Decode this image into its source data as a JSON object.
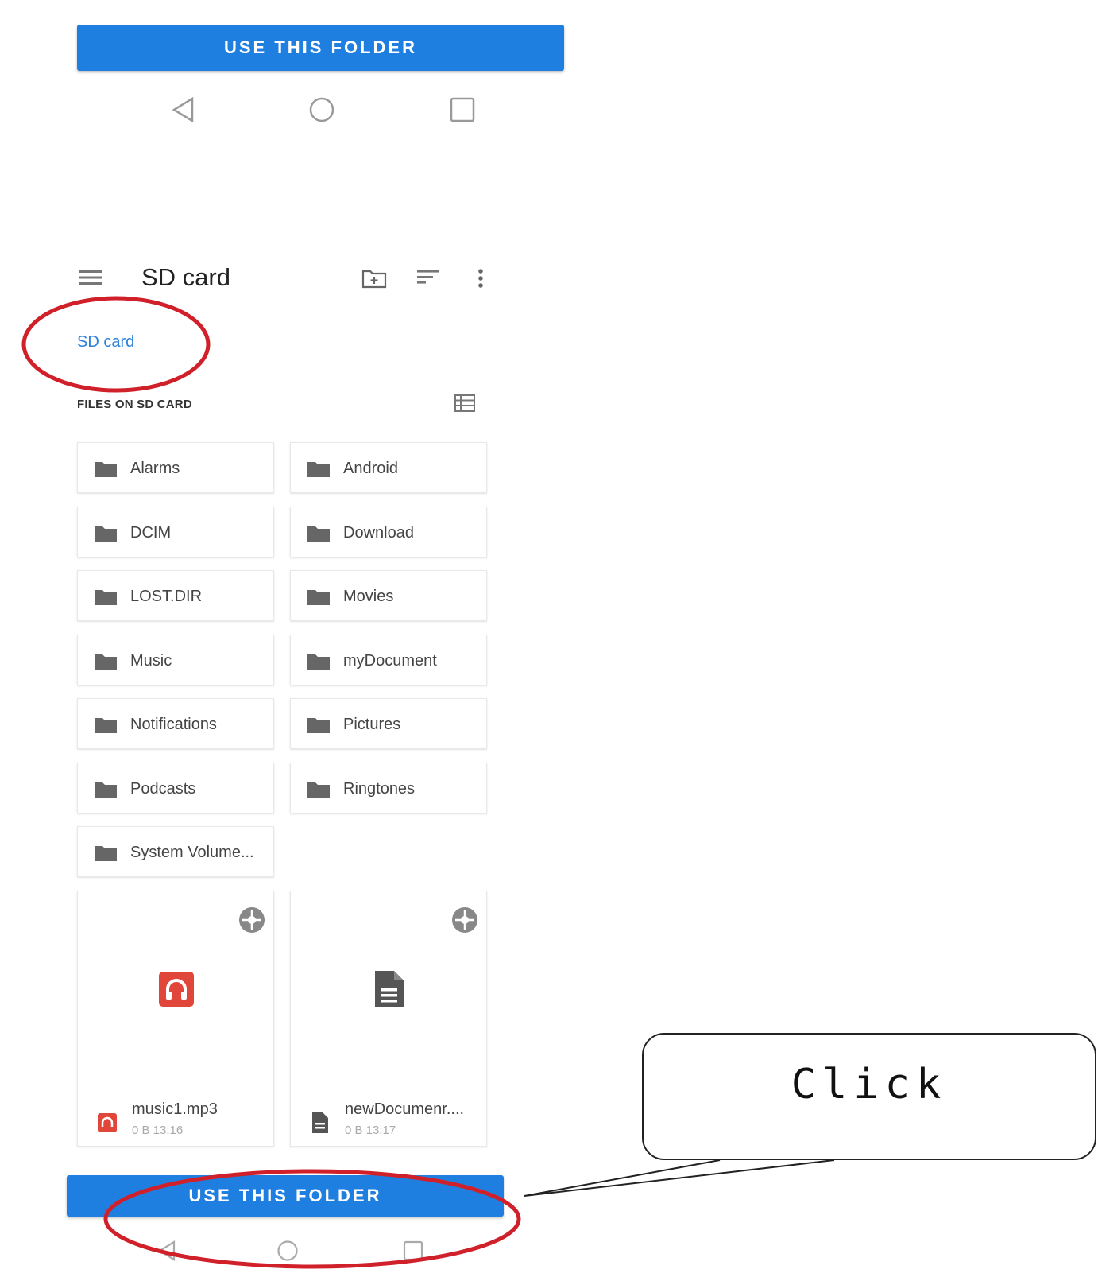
{
  "top_button": {
    "label": "USE THIS FOLDER"
  },
  "system_nav": {
    "back": "back-icon",
    "home": "home-icon",
    "recents": "recents-icon"
  },
  "toolbar": {
    "title": "SD card",
    "icons": [
      "menu-icon",
      "new-folder-icon",
      "sort-icon",
      "more-options-icon"
    ]
  },
  "breadcrumb": "SD card",
  "section": {
    "header": "FILES ON SD CARD",
    "view_toggle_icon": "list-view-icon"
  },
  "folders": [
    "Alarms",
    "Android",
    "DCIM",
    "Download",
    "LOST.DIR",
    "Movies",
    "Music",
    "myDocument",
    "Notifications",
    "Pictures",
    "Podcasts",
    "Ringtones",
    "System Volume..."
  ],
  "files": [
    {
      "name": "music1.mp3",
      "meta": "0 B 13:16",
      "icon": "audio-file-icon",
      "color": "#e0463a"
    },
    {
      "name": "newDocumenr....",
      "meta": "0 B 13:17",
      "icon": "document-file-icon",
      "color": "#555555"
    }
  ],
  "bottom_button": {
    "label": "USE THIS FOLDER"
  },
  "annotation": {
    "callout": "Click",
    "highlight_color": "#d0202a"
  },
  "colors": {
    "accent": "#1f7fe0",
    "link": "#2b82d9"
  }
}
